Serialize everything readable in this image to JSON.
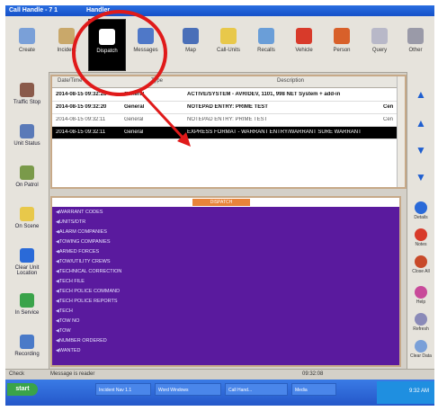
{
  "window": {
    "title": "Call Handle - 7 1",
    "title_right": "Handler"
  },
  "toolbar": {
    "buttons": [
      {
        "label": "Create",
        "icon": "form-icon",
        "color": "#7aa0d8"
      },
      {
        "label": "Incident",
        "icon": "document-icon",
        "color": "#c9a86a"
      },
      {
        "label": "Dispatch",
        "icon": "window-icon",
        "color": "#ffffff",
        "selected": true
      },
      {
        "label": "Messages",
        "icon": "person-icon",
        "color": "#4f78c8"
      },
      {
        "label": "Map",
        "icon": "map-icon",
        "color": "#4a6fb8"
      },
      {
        "label": "Call-Units",
        "icon": "star-icon",
        "color": "#e8c84a"
      },
      {
        "label": "Recalls",
        "icon": "refresh-icon",
        "color": "#6a9ed8"
      },
      {
        "label": "Vehicle",
        "icon": "vehicle-icon",
        "color": "#d83a2a"
      },
      {
        "label": "Person",
        "icon": "house-icon",
        "color": "#d8602a"
      },
      {
        "label": "Query",
        "icon": "query-icon",
        "color": "#b8b8c8"
      },
      {
        "label": "Other",
        "icon": "clock-icon",
        "color": "#9a9aa8"
      }
    ]
  },
  "left_panel": {
    "buttons": [
      {
        "label": "Traffic Stop",
        "icon": "stop-icon",
        "color": "#8a5a4a"
      },
      {
        "label": "Unit Status",
        "icon": "status-icon",
        "color": "#5a7ab8"
      },
      {
        "label": "On Patrol",
        "icon": "patrol-icon",
        "color": "#7a9a4a"
      },
      {
        "label": "On Scene",
        "icon": "star-icon",
        "color": "#e8c84a"
      },
      {
        "label": "Clear Unit Location",
        "icon": "forward-icon",
        "color": "#2a6ad8"
      },
      {
        "label": "In Service",
        "icon": "power-icon",
        "color": "#3aa34a"
      },
      {
        "label": "Recording",
        "icon": "refresh-icon",
        "color": "#4a7ac8"
      }
    ]
  },
  "right_panel": {
    "nav": [
      "up-icon",
      "up-icon",
      "down-icon",
      "down-icon"
    ],
    "tools": [
      {
        "label": "Details",
        "icon": "forward-icon",
        "color": "#2a6ad8"
      },
      {
        "label": "Notes",
        "icon": "stop-icon",
        "color": "#d83a2a"
      },
      {
        "label": "Close All",
        "icon": "person-icon",
        "color": "#c84a2a"
      },
      {
        "label": "Help",
        "icon": "help-icon",
        "color": "#c84a9a"
      },
      {
        "label": "Refresh",
        "icon": "clock-icon",
        "color": "#8a8ab8"
      },
      {
        "label": "Clear Data",
        "icon": "clear-icon",
        "color": "#7aa0d8"
      }
    ]
  },
  "grid": {
    "columns": [
      "Date/Time",
      "Type",
      "Description"
    ],
    "rows": [
      {
        "datetime": "2014-08-15 09:32:28",
        "type": "General",
        "description": "ACTIVE/SYSTEM - AVR/DEV, 1101, 998 NET System + add-in",
        "style": "bold"
      },
      {
        "datetime": "2014-08-15 09:32:20",
        "type": "General",
        "description": "NOTEPAD ENTRY: PRIME TEST",
        "right": "Cen",
        "style": "bold"
      },
      {
        "datetime": "2014-08-15 09:32:11",
        "type": "General",
        "description": "NOTEPAD ENTRY: PRIME TEST",
        "right": "Cen",
        "style": "normal"
      },
      {
        "datetime": "2014-08-15 09:32:11",
        "type": "General",
        "description": "EXPRESS FORMAT - WARRANT ENTRY/WARRANT SURE WARRANT",
        "style": "selected"
      }
    ]
  },
  "dispatch_list": {
    "header_tag": "DISPATCH",
    "items": [
      "WARRANT CODES",
      "UNITS/DTR",
      "ALARM COMPANIES",
      "TOWING COMPANIES",
      "ARMED FORCES",
      "TOW/UTILITY CREWS",
      "TECHNICAL CORRECTION",
      "TECH FILE",
      "TECH POLICE COMMAND",
      "TECH POLICE REPORTS",
      "TECH",
      "TOW NO",
      "TOW",
      "NUMBER ORDERED",
      "WANTED"
    ]
  },
  "statusbar": {
    "left": "Check",
    "middle": "Message is reader",
    "right": "09:32:08"
  },
  "taskbar": {
    "start_label": "start",
    "tasks": [
      "Incident Nav 1.1",
      "Word Windows",
      "Call Hand...",
      "Media"
    ],
    "clock": "9:32 AM"
  },
  "annotation_colors": {
    "highlight": "#e01a1a"
  }
}
